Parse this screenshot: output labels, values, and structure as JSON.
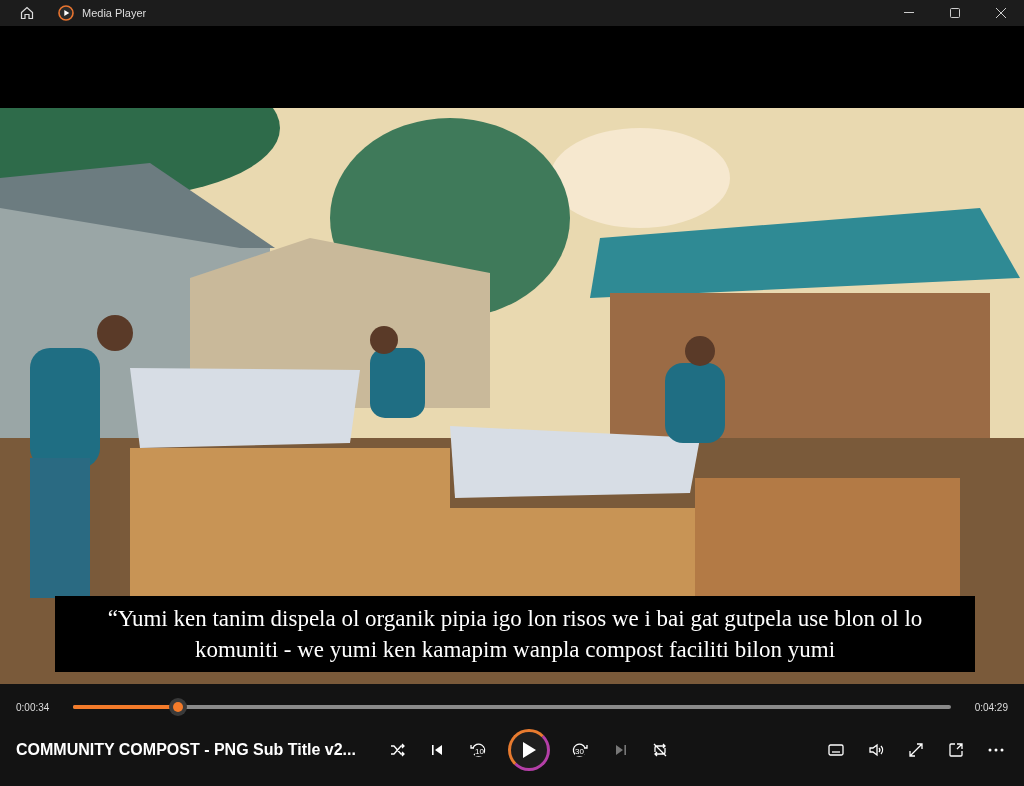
{
  "window": {
    "title": "Media Player"
  },
  "subtitle_lines": [
    "“Yumi ken tanim dispela ol organik pipia igo lon risos we i bai gat gutpela use blon ol lo",
    "komuniti - we yumi ken kamapim wanpla compost faciliti bilon yumi"
  ],
  "progress": {
    "elapsed": "0:00:34",
    "total": "0:04:29",
    "level": 0.119
  },
  "now_playing": {
    "title": "COMMUNITY COMPOST - PNG Sub Title v2..."
  },
  "controls": [
    {
      "kind": "shuffle",
      "disabled": false
    },
    {
      "kind": "previous",
      "disabled": false
    },
    {
      "kind": "back10",
      "label": "10",
      "disabled": false
    },
    {
      "kind": "play",
      "disabled": false
    },
    {
      "kind": "forward30",
      "label": "30",
      "disabled": false
    },
    {
      "kind": "next",
      "disabled": true
    },
    {
      "kind": "repeat",
      "disabled": false
    }
  ],
  "right_controls": [
    {
      "kind": "captions"
    },
    {
      "kind": "volume"
    },
    {
      "kind": "fullscreen"
    },
    {
      "kind": "miniplayer"
    },
    {
      "kind": "more"
    }
  ]
}
